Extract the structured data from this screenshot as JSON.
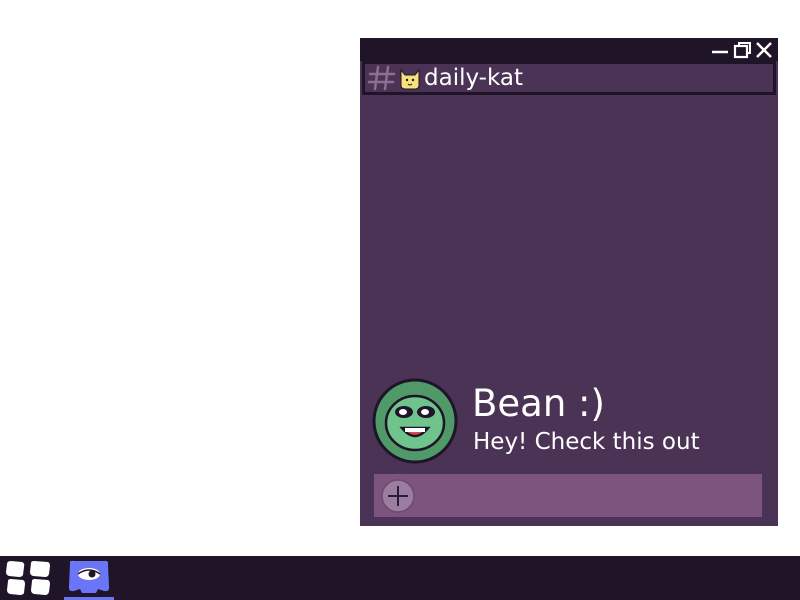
{
  "window": {
    "controls": {
      "minimize_icon": "minimize-icon",
      "maximize_icon": "maximize-icon",
      "close_icon": "close-icon"
    }
  },
  "channel": {
    "prefix_icon": "hash-icon",
    "emoji_icon": "cat-face-icon",
    "name": "daily-kat"
  },
  "messages": [
    {
      "author": "Bean :)",
      "text": "Hey! Check this out",
      "avatar_icon": "green-smiley-avatar"
    }
  ],
  "composer": {
    "add_icon": "plus-circle-icon",
    "placeholder": ""
  },
  "taskbar": {
    "start_icon": "start-menu-icon",
    "apps": [
      {
        "icon": "chat-app-icon",
        "active": true
      }
    ]
  },
  "colors": {
    "window_bg": "#4a3354",
    "titlebar_bg": "#1f1428",
    "input_bg": "#7c557f",
    "avatar_green": "#4f9a68",
    "cat_yellow": "#f6e27a",
    "app_accent": "#6a76f5",
    "text": "#ffffff"
  }
}
